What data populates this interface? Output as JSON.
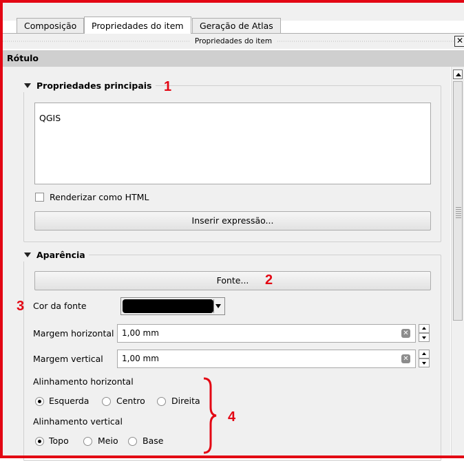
{
  "tabs": [
    {
      "label": "Composição",
      "active": false
    },
    {
      "label": "Propriedades do item",
      "active": true
    },
    {
      "label": "Geração de Atlas",
      "active": false
    }
  ],
  "dock": {
    "title": "Propriedades do item",
    "close_icon": "close-icon",
    "close_glyph": "✕"
  },
  "section": {
    "title": "Rótulo"
  },
  "main_props": {
    "title": "Propriedades principais",
    "label_text": "QGIS",
    "render_html_label": "Renderizar como HTML",
    "render_html_checked": false,
    "insert_expression_label": "Inserir expressão..."
  },
  "appearance": {
    "title": "Aparência",
    "font_button_label": "Fonte...",
    "font_color_label": "Cor da fonte",
    "font_color": "#000000",
    "margin_h_label": "Margem horizontal",
    "margin_h_value": "1,00 mm",
    "margin_v_label": "Margem vertical",
    "margin_v_value": "1,00 mm",
    "h_align_label": "Alinhamento horizontal",
    "h_align_options": [
      "Esquerda",
      "Centro",
      "Direita"
    ],
    "h_align_selected": "Esquerda",
    "v_align_label": "Alinhamento vertical",
    "v_align_options": [
      "Topo",
      "Meio",
      "Base"
    ],
    "v_align_selected": "Topo"
  },
  "annotations": {
    "n1": "1",
    "n2": "2",
    "n3": "3",
    "n4": "4",
    "color": "#e30613"
  }
}
